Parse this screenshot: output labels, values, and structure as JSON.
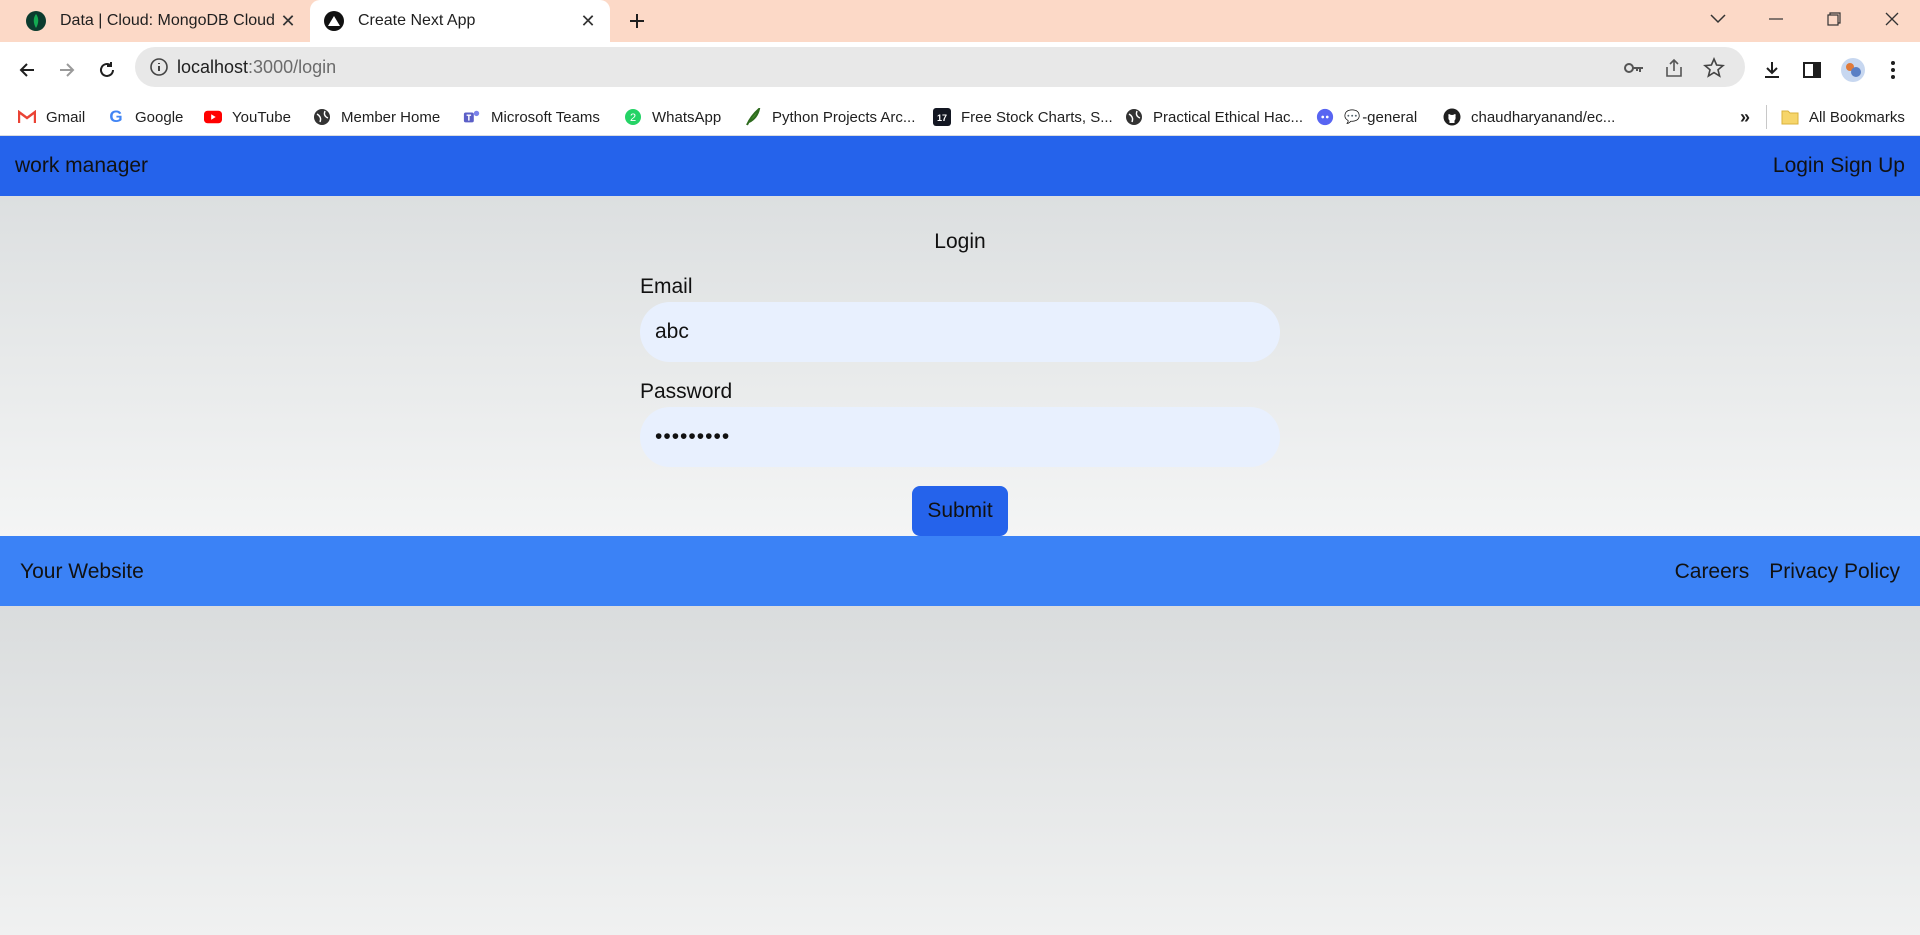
{
  "browser": {
    "tabs": [
      {
        "title": "Data | Cloud: MongoDB Cloud",
        "icon": "mongodb-leaf-icon"
      },
      {
        "title": "Create Next App",
        "icon": "nextjs-triangle-icon"
      }
    ],
    "url_host": "localhost",
    "url_path": ":3000/login",
    "bookmarks": [
      {
        "label": "Gmail",
        "icon": "gmail-icon"
      },
      {
        "label": "Google",
        "icon": "google-icon"
      },
      {
        "label": "YouTube",
        "icon": "youtube-icon"
      },
      {
        "label": "Member Home",
        "icon": "globe-icon"
      },
      {
        "label": "Microsoft Teams",
        "icon": "teams-icon"
      },
      {
        "label": "WhatsApp",
        "icon": "whatsapp-icon"
      },
      {
        "label": "Python Projects Arc...",
        "icon": "feather-icon"
      },
      {
        "label": "Free Stock Charts, S...",
        "icon": "tradingview-icon"
      },
      {
        "label": "Practical Ethical Hac...",
        "icon": "globe-icon"
      },
      {
        "label": "-general",
        "icon": "discord-icon"
      },
      {
        "label": "chaudharyanand/ec...",
        "icon": "github-icon"
      }
    ],
    "more_bookmarks": "»",
    "all_bookmarks": "All Bookmarks"
  },
  "app": {
    "brand": "work manager",
    "nav_login": "Login",
    "nav_signup": "Sign Up",
    "form": {
      "title": "Login",
      "email_label": "Email",
      "email_value": "abc",
      "password_label": "Password",
      "password_value": "•••••••••",
      "submit_label": "Submit"
    },
    "footer": {
      "site": "Your Website",
      "careers": "Careers",
      "privacy": "Privacy Policy"
    }
  },
  "colors": {
    "nav_bg": "#2563eb",
    "footer_bg": "#3b82f6",
    "input_bg": "#e8f0fe",
    "tabstrip_bg": "#fcd9c7"
  }
}
